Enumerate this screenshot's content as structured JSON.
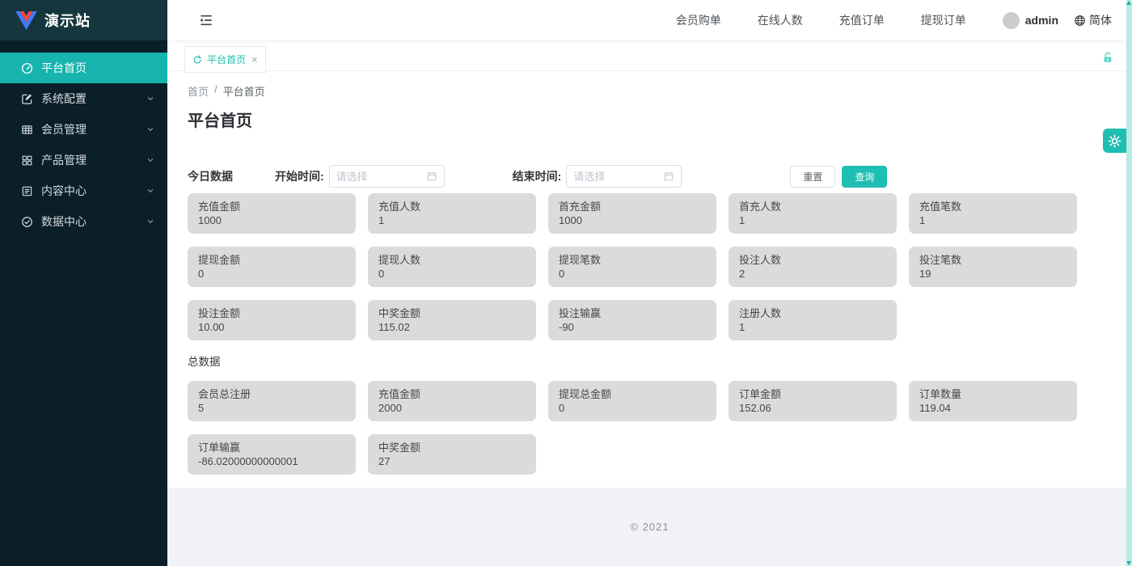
{
  "app": {
    "title": "演示站"
  },
  "colors": {
    "accent": "#1fbeb2",
    "sidebar_active": "#17b3ad",
    "sidebar_bg": "#0a1f28",
    "logo_bg": "#16363f",
    "card_bg": "#dbdbdb",
    "scrollbar_track": "#b6ebe4",
    "scrollbar_arrow": "#1fae9f",
    "lock_color": "#5ed5ca"
  },
  "sidebar": {
    "items": [
      {
        "label": "平台首页",
        "icon": "dashboard-icon",
        "active": true,
        "has_children": false
      },
      {
        "label": "系统配置",
        "icon": "edit-square-icon",
        "active": false,
        "has_children": true
      },
      {
        "label": "会员管理",
        "icon": "table-icon",
        "active": false,
        "has_children": true
      },
      {
        "label": "产品管理",
        "icon": "grid-icon",
        "active": false,
        "has_children": true
      },
      {
        "label": "内容中心",
        "icon": "document-icon",
        "active": false,
        "has_children": true
      },
      {
        "label": "数据中心",
        "icon": "check-circle-icon",
        "active": false,
        "has_children": true
      }
    ]
  },
  "header": {
    "links": [
      {
        "label": "会员购单"
      },
      {
        "label": "在线人数"
      },
      {
        "label": "充值订单"
      },
      {
        "label": "提现订单"
      }
    ],
    "username": "admin",
    "language": "简体"
  },
  "tabbar": {
    "tabs": [
      {
        "label": "平台首页"
      }
    ]
  },
  "breadcrumb": {
    "home": "首页",
    "separator": "/",
    "current": "平台首页"
  },
  "page": {
    "title": "平台首页"
  },
  "filters": {
    "today_label": "今日数据",
    "start_label": "开始时间:",
    "end_label": "结束时间:",
    "date_placeholder": "请选择",
    "reset_button": "重置",
    "search_button": "查询"
  },
  "today_stats": [
    {
      "label": "充值金额",
      "value": "1000"
    },
    {
      "label": "充值人数",
      "value": "1"
    },
    {
      "label": "首充金额",
      "value": "1000"
    },
    {
      "label": "首充人数",
      "value": "1"
    },
    {
      "label": "充值笔数",
      "value": "1"
    },
    {
      "label": "提现金额",
      "value": "0"
    },
    {
      "label": "提现人数",
      "value": "0"
    },
    {
      "label": "提现笔数",
      "value": "0"
    },
    {
      "label": "投注人数",
      "value": "2"
    },
    {
      "label": "投注笔数",
      "value": "19"
    },
    {
      "label": "投注金额",
      "value": "10.00"
    },
    {
      "label": "中奖金额",
      "value": "115.02"
    },
    {
      "label": "投注输赢",
      "value": "-90"
    },
    {
      "label": "注册人数",
      "value": "1"
    }
  ],
  "totals": {
    "section_label": "总数据",
    "stats": [
      {
        "label": "会员总注册",
        "value": "5"
      },
      {
        "label": "充值金额",
        "value": "2000"
      },
      {
        "label": "提现总金额",
        "value": "0"
      },
      {
        "label": "订单金额",
        "value": "152.06"
      },
      {
        "label": "订单数量",
        "value": "119.04"
      },
      {
        "label": "订单输赢",
        "value": "-86.02000000000001"
      },
      {
        "label": "中奖金额",
        "value": "27"
      }
    ]
  },
  "footer": {
    "copyright": "© 2021"
  }
}
